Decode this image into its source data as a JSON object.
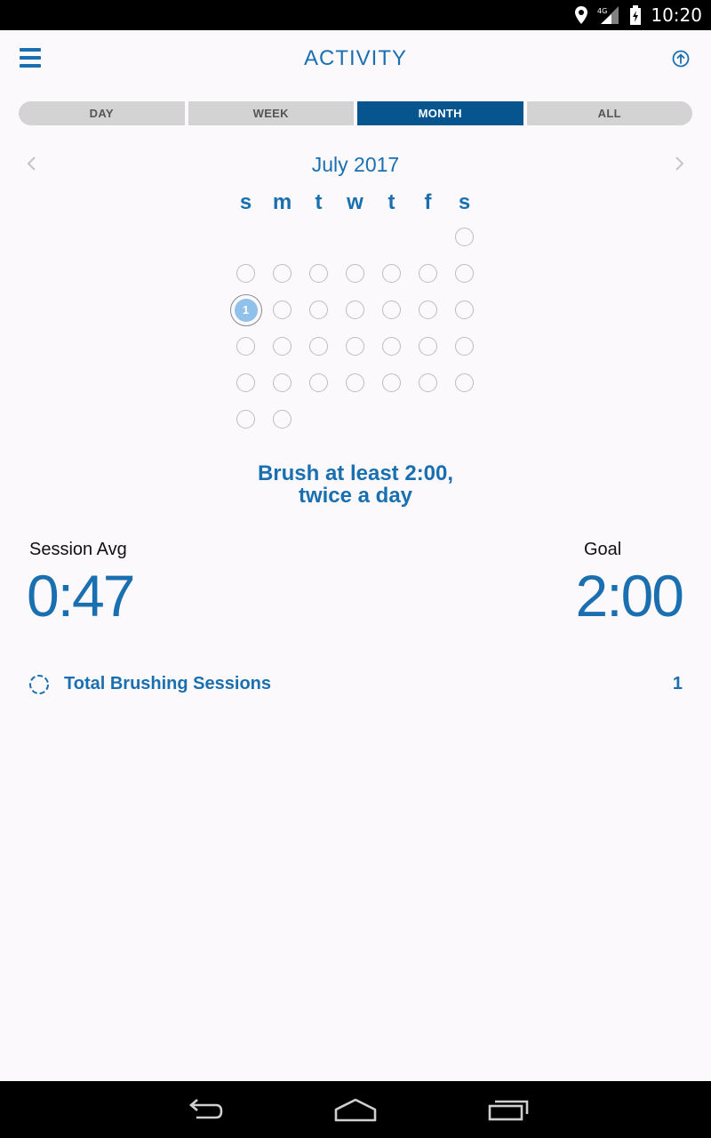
{
  "status_bar": {
    "time": "10:20",
    "network": "4G"
  },
  "header": {
    "title": "ACTIVITY"
  },
  "tabs": [
    {
      "label": "DAY",
      "active": false
    },
    {
      "label": "WEEK",
      "active": false
    },
    {
      "label": "MONTH",
      "active": true
    },
    {
      "label": "ALL",
      "active": false
    }
  ],
  "calendar": {
    "month_label": "July 2017",
    "weekdays": [
      "s",
      "m",
      "t",
      "w",
      "t",
      "f",
      "s"
    ],
    "leading_blank_days": 6,
    "days_in_month": 31,
    "highlighted_day_index": 8,
    "highlighted_label": "1"
  },
  "motto": {
    "line1": "Brush at least 2:00,",
    "line2": "twice a day"
  },
  "stats": {
    "session_avg_label": "Session Avg",
    "session_avg_value": "0:47",
    "goal_label": "Goal",
    "goal_value": "2:00"
  },
  "sessions": {
    "label": "Total Brushing Sessions",
    "count": "1"
  },
  "colors": {
    "accent": "#1a6fb0",
    "active_tab": "#06558e",
    "tab_bg": "#d3d3d3",
    "highlight": "#8fc1ea"
  }
}
